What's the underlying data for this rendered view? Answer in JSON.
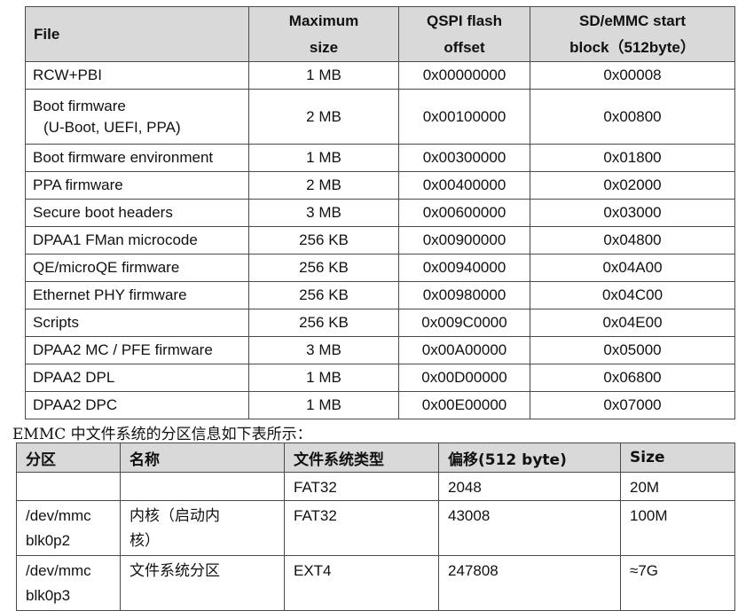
{
  "top_fragment": "",
  "table1": {
    "headers": {
      "file": "File",
      "max_size_1": "Maximum",
      "max_size_2": "size",
      "qspi_1": "QSPI flash",
      "qspi_2": "offset",
      "sd_1": "SD/eMMC start",
      "sd_2": "block（512byte）"
    },
    "rows": [
      {
        "file": "RCW+PBI",
        "size": "1 MB",
        "qspi": "0x00000000",
        "sd": "0x00008"
      },
      {
        "file": "Boot firmware",
        "file2": "(U-Boot, UEFI, PPA)",
        "size": "2 MB",
        "qspi": "0x00100000",
        "sd": "0x00800"
      },
      {
        "file": "Boot firmware environment",
        "size": "1 MB",
        "qspi": "0x00300000",
        "sd": "0x01800"
      },
      {
        "file": "PPA firmware",
        "size": "2 MB",
        "qspi": "0x00400000",
        "sd": "0x02000"
      },
      {
        "file": "Secure boot headers",
        "size": "3 MB",
        "qspi": "0x00600000",
        "sd": "0x03000"
      },
      {
        "file": "DPAA1 FMan microcode",
        "size": "256 KB",
        "qspi": "0x00900000",
        "sd": "0x04800"
      },
      {
        "file": "QE/microQE firmware",
        "size": "256 KB",
        "qspi": "0x00940000",
        "sd": "0x04A00"
      },
      {
        "file": "Ethernet PHY firmware",
        "size": "256 KB",
        "qspi": "0x00980000",
        "sd": "0x04C00"
      },
      {
        "file": "Scripts",
        "size": "256 KB",
        "qspi": "0x009C0000",
        "sd": "0x04E00"
      },
      {
        "file": "DPAA2 MC / PFE firmware",
        "size": "3 MB",
        "qspi": "0x00A00000",
        "sd": "0x05000"
      },
      {
        "file": "DPAA2 DPL",
        "size": "1 MB",
        "qspi": "0x00D00000",
        "sd": "0x06800"
      },
      {
        "file": "DPAA2 DPC",
        "size": "1 MB",
        "qspi": "0x00E00000",
        "sd": "0x07000"
      }
    ]
  },
  "caption": "EMMC 中文件系统的分区信息如下表所示：",
  "table2": {
    "headers": {
      "partition": "分区",
      "name": "名称",
      "fs_type": "文件系统类型",
      "offset": "偏移(512 byte)",
      "size": "Size"
    },
    "rows": [
      {
        "partition_1": "",
        "partition_2": "",
        "name_1": "",
        "name_2": "",
        "fs_type": "FAT32",
        "offset": "2048",
        "size": "20M"
      },
      {
        "partition_1": "/dev/mmc",
        "partition_2": "blk0p2",
        "name_1": "内核（启动内",
        "name_2": "核）",
        "fs_type": "FAT32",
        "offset": "43008",
        "size": "100M"
      },
      {
        "partition_1": "/dev/mmc",
        "partition_2": "blk0p3",
        "name_1": "文件系统分区",
        "name_2": "",
        "fs_type": "EXT4",
        "offset": "247808",
        "size": "≈7G"
      }
    ]
  }
}
